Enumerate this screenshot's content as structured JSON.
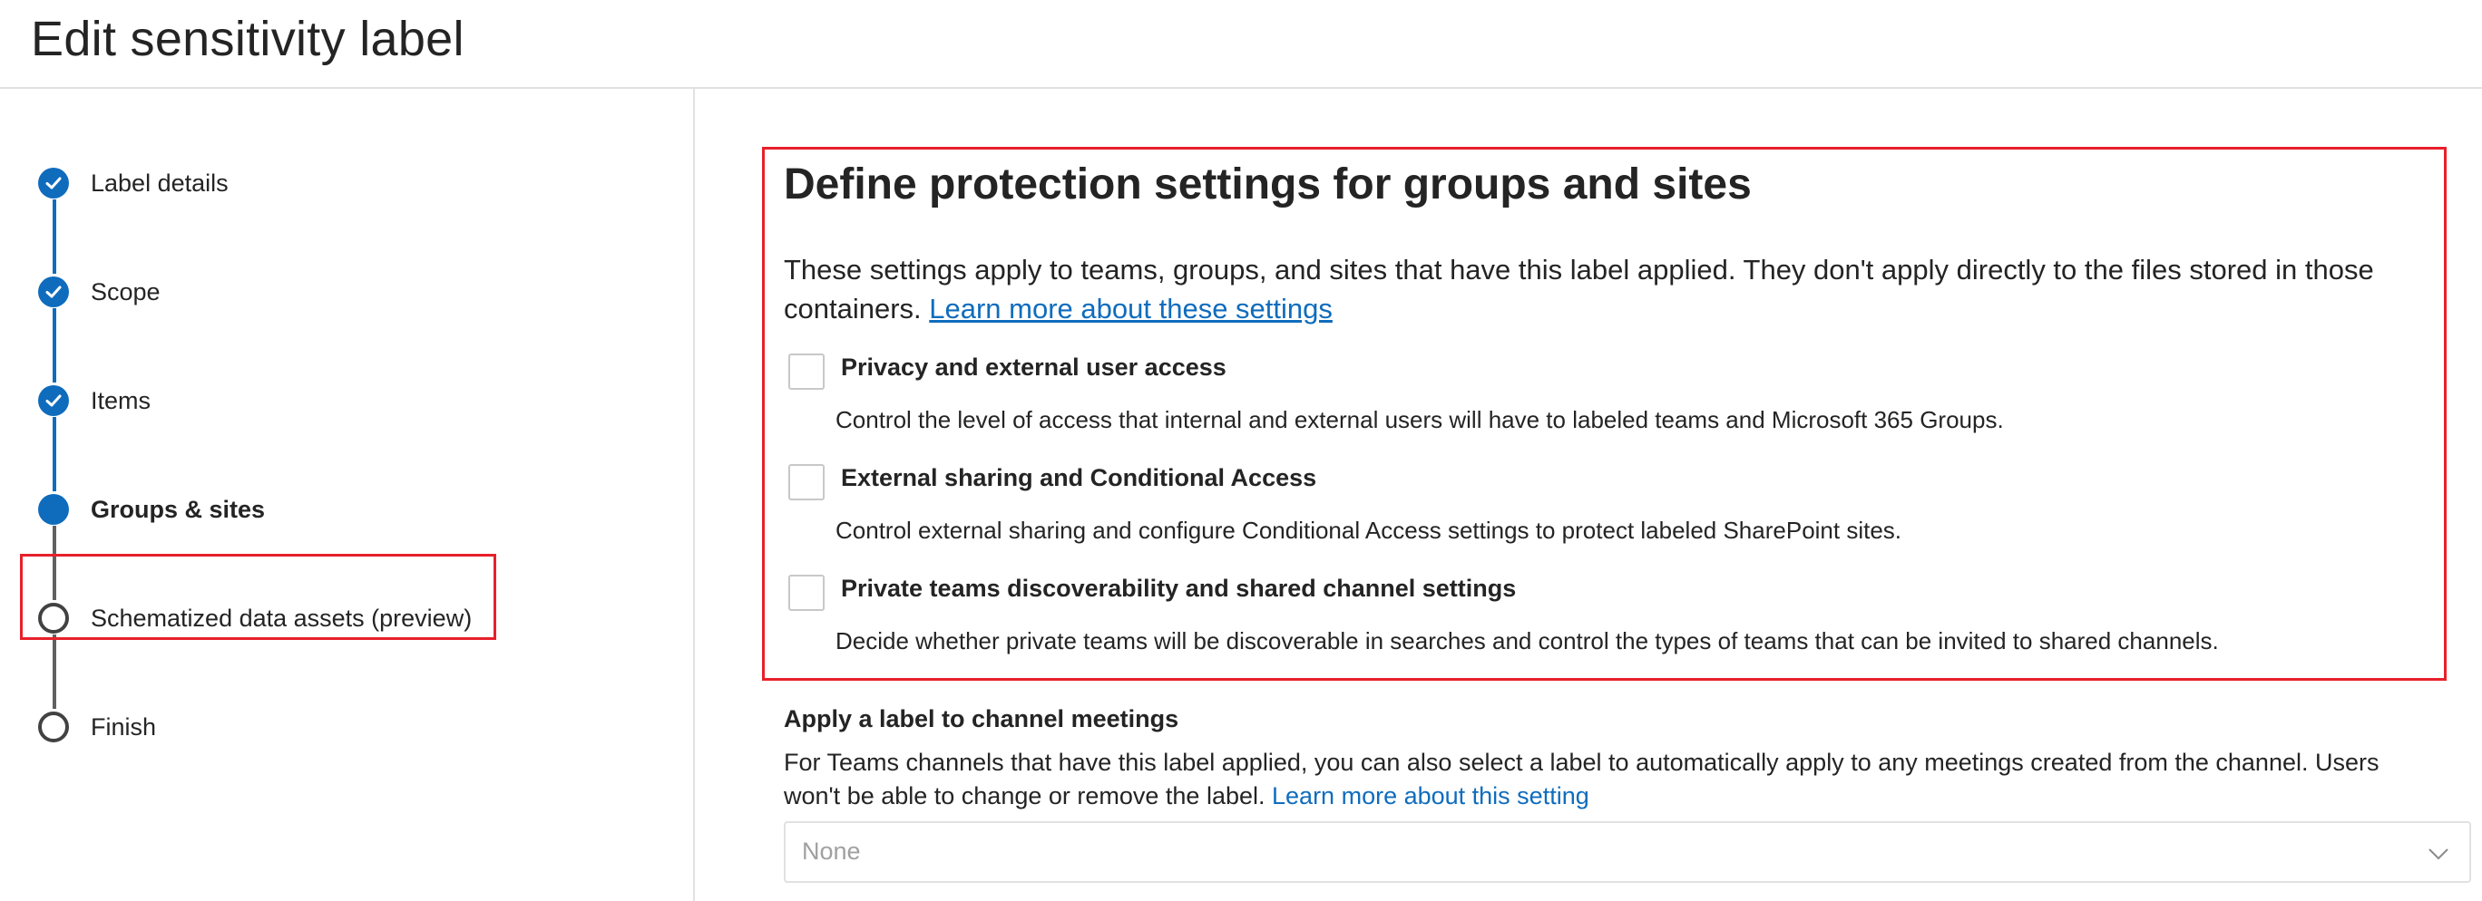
{
  "header": {
    "title": "Edit sensitivity label"
  },
  "wizard": {
    "steps": [
      {
        "label": "Label details",
        "state": "done"
      },
      {
        "label": "Scope",
        "state": "done"
      },
      {
        "label": "Items",
        "state": "done"
      },
      {
        "label": "Groups & sites",
        "state": "current"
      },
      {
        "label": "Schematized data assets (preview)",
        "state": "todo"
      },
      {
        "label": "Finish",
        "state": "todo"
      }
    ]
  },
  "protection": {
    "heading": "Define protection settings for groups and sites",
    "description": "These settings apply to teams, groups, and sites that have this label applied. They don't apply directly to the files stored in those containers.",
    "learn_more": "Learn more about these settings",
    "options": [
      {
        "title": "Privacy and external user access",
        "description": "Control the level of access that internal and external users will have to labeled teams and Microsoft 365 Groups.",
        "checked": false
      },
      {
        "title": "External sharing and Conditional Access",
        "description": "Control external sharing and configure Conditional Access settings to protect labeled SharePoint sites.",
        "checked": false
      },
      {
        "title": "Private teams discoverability and shared channel settings",
        "description": "Decide whether private teams will be discoverable in searches and control the types of teams that can be invited to shared channels.",
        "checked": false
      }
    ]
  },
  "channel_meetings": {
    "title": "Apply a label to channel meetings",
    "description": "For Teams channels that have this label applied, you can also select a label to automatically apply to any meetings created from the channel. Users won't be able to change or remove the label.",
    "learn_more": "Learn more about this setting",
    "select_value": "None"
  },
  "colors": {
    "accent": "#0f6cbd",
    "highlight_border": "#e8202a",
    "text": "#242424",
    "divider": "#e1e1e1"
  }
}
